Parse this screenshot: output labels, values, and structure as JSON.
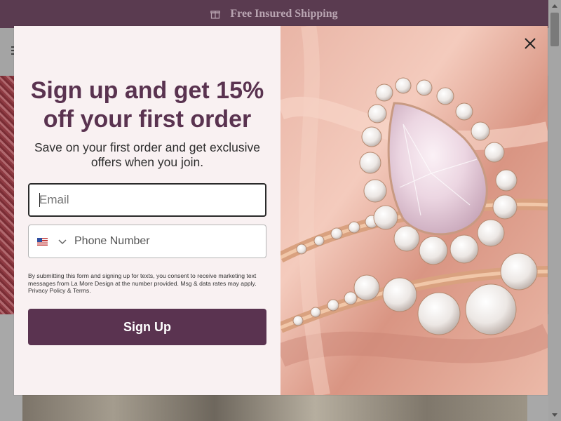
{
  "announcement": {
    "text": "Free Insured Shipping",
    "icon": "gift-icon"
  },
  "popup": {
    "headline": "Sign up and get 15% off your first order",
    "subheadline": "Save on your first order and get exclusive offers when you join.",
    "email": {
      "placeholder": "Email",
      "value": ""
    },
    "phone": {
      "placeholder": "Phone Number",
      "value": "",
      "country_flag": "us-flag-icon"
    },
    "legal_text": "By submitting this form and signing up for texts, you consent to receive marketing text messages from La More Design at the number provided. Msg & data rates may apply. Privacy Policy & Terms.",
    "submit_label": "Sign Up",
    "close_icon": "close-icon",
    "image": "rose-gold-pear-halo-diamond-ring-photo"
  },
  "colors": {
    "brand_plum": "#5a3350",
    "popup_background": "#f9f1f2",
    "announcement_bar": "#5a3b50",
    "rose_gold": "#d9a17f"
  }
}
